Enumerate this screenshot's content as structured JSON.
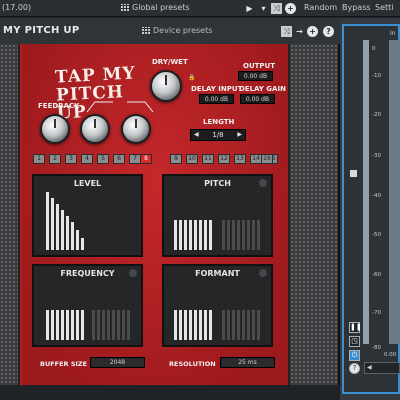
{
  "host": {
    "version": "(17.00)",
    "global_presets_label": "Global presets",
    "random_label": "Random",
    "bypass_label": "Bypass",
    "settings_label": "Setti"
  },
  "device": {
    "name": "MY PITCH UP",
    "presets_label": "Device presets",
    "help_icon": "?"
  },
  "plugin": {
    "logo_text": "TAP MY PITCH UP",
    "drywet_label": "DRY/WET",
    "output_label": "OUTPUT",
    "output_value": "0.00 dB",
    "delay_input_label": "DELAY INPUT",
    "delay_input_value": "0.00 dB",
    "delay_gain_label": "DELAY GAIN",
    "delay_gain_value": "0.00 dB",
    "feedback_label": "FEEDBACK",
    "length_label": "LENGTH",
    "length_value": "1/8",
    "steps": [
      "1",
      "2",
      "3",
      "4",
      "5",
      "6",
      "7",
      "8",
      "9",
      "10",
      "11",
      "12",
      "13",
      "14",
      "15",
      "16"
    ],
    "active_step": 8,
    "panels": {
      "level": "LEVEL",
      "pitch": "PITCH",
      "frequency": "FREQUENCY",
      "formant": "FORMANT"
    },
    "buffer_size_label": "BUFFER SIZE",
    "buffer_size_value": "2048",
    "resolution_label": "RESOLUTION",
    "resolution_value": "25 ms"
  },
  "sidepanel": {
    "in_label": "In",
    "scale": [
      "0",
      "-10",
      "-20",
      "-30",
      "-40",
      "-50",
      "-60",
      "-70",
      "-80"
    ],
    "readout": "0.00",
    "help_icon": "?"
  },
  "colors": {
    "accent_blue": "#3c8fd0",
    "plugin_red": "#b21e22",
    "active_step_red": "#d92a2e"
  }
}
